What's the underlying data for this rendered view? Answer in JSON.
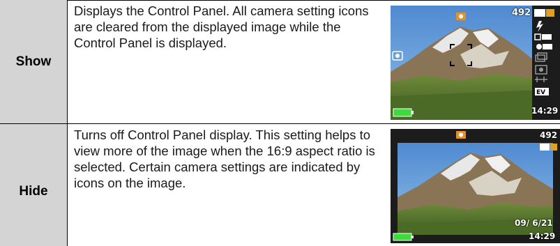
{
  "rows": [
    {
      "label": "Show",
      "description": "Displays the Control Panel. All camera setting icons are cleared from the displayed image while the Control Panel is displayed.",
      "screen": {
        "shot_count": "492",
        "time": "14:29",
        "icons": [
          "camera-icon",
          "image-size-icon",
          "flash-auto-icon",
          "af-icon",
          "face-detect-icon",
          "continuous-shot-icon",
          "self-timer-icon",
          "anti-shake-icon",
          "ev-icon",
          "battery-icon",
          "focus-frame-icon",
          "face-icon"
        ]
      }
    },
    {
      "label": "Hide",
      "description": "Turns off Control Panel display. This setting helps to view more of the image when the 16:9 aspect ratio is selected. Certain camera settings are indicated by icons on the image.",
      "screen": {
        "shot_count": "492",
        "date": "09/ 6/21",
        "time": "14:29",
        "icons": [
          "camera-icon",
          "image-size-icon",
          "battery-icon"
        ]
      }
    }
  ],
  "colors": {
    "label_bg": "#d4d4d4",
    "sky": "#5f98d6",
    "battery": "#3ddc3d",
    "camera_icon": "#e0922e"
  }
}
